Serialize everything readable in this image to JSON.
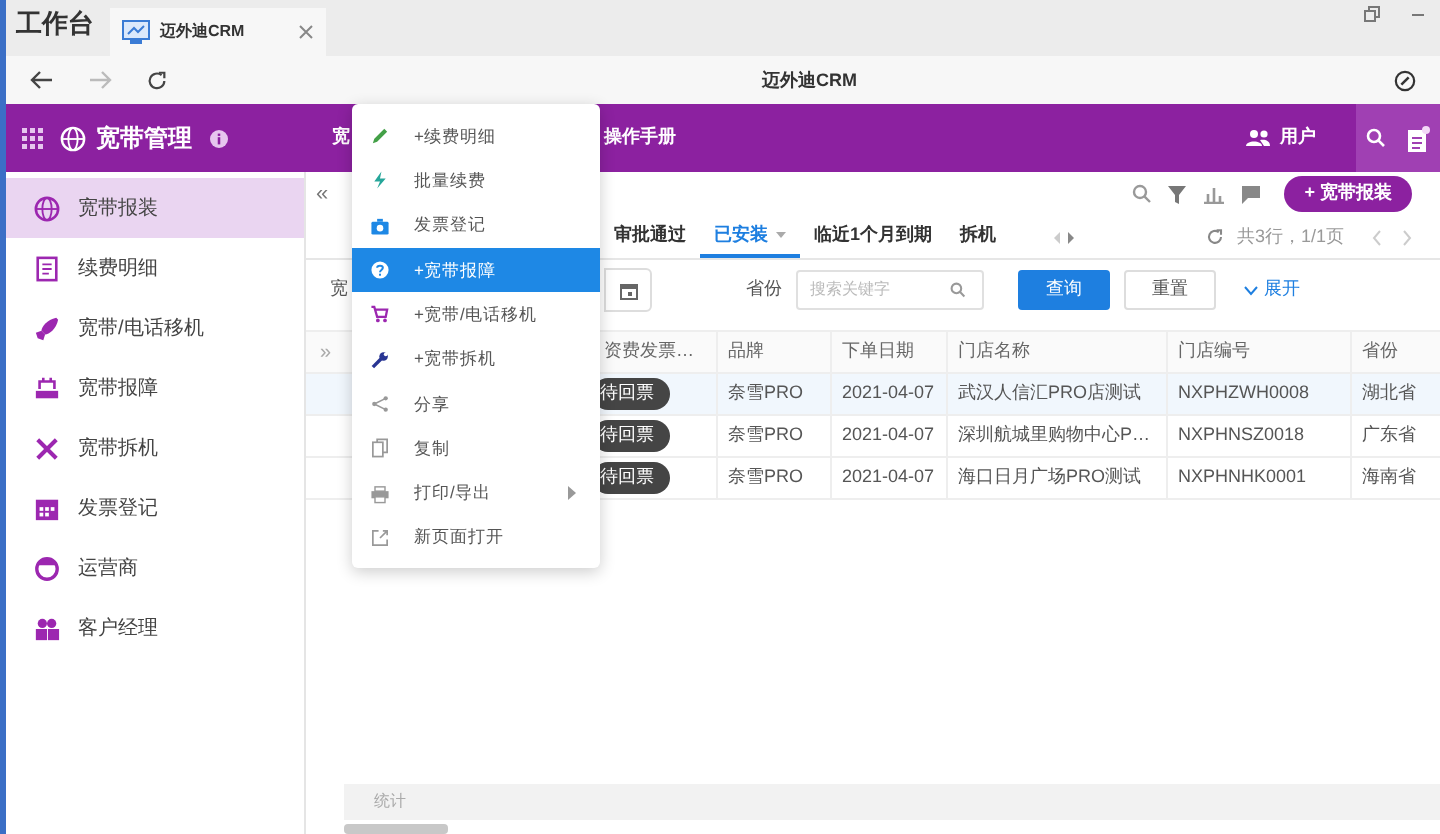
{
  "window": {
    "workspace": "工作台",
    "tab_title": "迈外迪CRM",
    "address_title": "迈外迪CRM"
  },
  "header": {
    "app": "宽带管理",
    "nav": [
      "宽",
      "操作手册"
    ],
    "user": "用户"
  },
  "sidebar": {
    "items": [
      {
        "label": "宽带报装",
        "selected": true
      },
      {
        "label": "续费明细",
        "selected": false
      },
      {
        "label": "宽带/电话移机",
        "selected": false
      },
      {
        "label": "宽带报障",
        "selected": false
      },
      {
        "label": "宽带拆机",
        "selected": false
      },
      {
        "label": "发票登记",
        "selected": false
      },
      {
        "label": "运营商",
        "selected": false
      },
      {
        "label": "客户经理",
        "selected": false
      }
    ]
  },
  "page": {
    "collapse": "«",
    "add_button": "+ 宽带报装"
  },
  "tabs": [
    {
      "label": "审批通过",
      "selected": false,
      "dropdown": false
    },
    {
      "label": "已安装",
      "selected": true,
      "dropdown": true
    },
    {
      "label": "临近1个月到期",
      "selected": false,
      "dropdown": false
    },
    {
      "label": "拆机",
      "selected": false,
      "dropdown": false
    }
  ],
  "pager": {
    "summary": "共3行，1/1页"
  },
  "filters": {
    "first_label": "宽",
    "province_label": "省份",
    "search_placeholder": "搜索关键字",
    "query_button": "查询",
    "reset_button": "重置",
    "expand": "展开"
  },
  "table": {
    "expander": "»",
    "columns": [
      "资费发票…",
      "品牌",
      "下单日期",
      "门店名称",
      "门店编号",
      "省份"
    ],
    "rows": [
      {
        "selected": true,
        "cells": [
          "待回票",
          "奈雪PRO",
          "2021-04-07",
          "武汉人信汇PRO店测试",
          "NXPHZWH0008",
          "湖北省"
        ]
      },
      {
        "selected": false,
        "cells": [
          "待回票",
          "奈雪PRO",
          "2021-04-07",
          "深圳航城里购物中心P…",
          "NXPHNSZ0018",
          "广东省"
        ]
      },
      {
        "selected": false,
        "cells": [
          "待回票",
          "奈雪PRO",
          "2021-04-07",
          "海口日月广场PRO测试",
          "NXPHNHK0001",
          "海南省"
        ]
      }
    ]
  },
  "footer": {
    "summary": "统计"
  },
  "context_menu": {
    "items": [
      {
        "label": "+续费明细",
        "selected": false,
        "submenu": false
      },
      {
        "label": "批量续费",
        "selected": false,
        "submenu": false
      },
      {
        "label": "发票登记",
        "selected": false,
        "submenu": false
      },
      {
        "label": "+宽带报障",
        "selected": true,
        "submenu": false
      },
      {
        "label": "+宽带/电话移机",
        "selected": false,
        "submenu": false
      },
      {
        "label": "+宽带拆机",
        "selected": false,
        "submenu": false
      },
      {
        "label": "分享",
        "selected": false,
        "submenu": false
      },
      {
        "label": "复制",
        "selected": false,
        "submenu": false
      },
      {
        "label": "打印/导出",
        "selected": false,
        "submenu": true
      },
      {
        "label": "新页面打开",
        "selected": false,
        "submenu": false
      }
    ]
  }
}
